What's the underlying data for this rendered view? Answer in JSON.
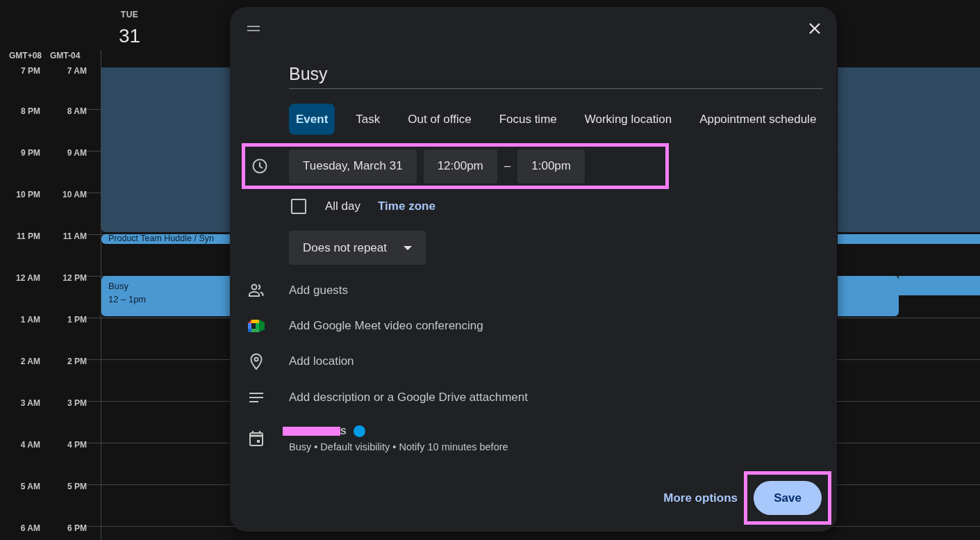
{
  "day": {
    "weekday": "TUE",
    "date": "31"
  },
  "timezones": [
    "GMT+08",
    "GMT-04"
  ],
  "hours": [
    {
      "local": "7 PM",
      "other": "7 AM"
    },
    {
      "local": "8 PM",
      "other": "8 AM"
    },
    {
      "local": "9 PM",
      "other": "9 AM"
    },
    {
      "local": "10 PM",
      "other": "10 AM"
    },
    {
      "local": "11 PM",
      "other": "11 AM"
    },
    {
      "local": "12 AM",
      "other": "12 PM"
    },
    {
      "local": "1 AM",
      "other": "1 PM"
    },
    {
      "local": "2 AM",
      "other": "2 PM"
    },
    {
      "local": "3 AM",
      "other": "3 PM"
    },
    {
      "local": "4 AM",
      "other": "4 PM"
    },
    {
      "local": "5 AM",
      "other": "5 PM"
    },
    {
      "local": "6 AM",
      "other": "6 PM"
    }
  ],
  "events": [
    {
      "kind": "block"
    },
    {
      "kind": "chip",
      "title": "Product Team Huddle / Syn"
    },
    {
      "kind": "timed",
      "title": "Busy",
      "time": "12 – 1pm"
    },
    {
      "kind": "strip"
    }
  ],
  "dialog": {
    "title_value": "Busy",
    "tabs": [
      {
        "label": "Event",
        "selected": true
      },
      {
        "label": "Task",
        "selected": false
      },
      {
        "label": "Out of office",
        "selected": false
      },
      {
        "label": "Focus time",
        "selected": false
      },
      {
        "label": "Working location",
        "selected": false
      },
      {
        "label": "Appointment schedule",
        "selected": false
      }
    ],
    "datetime": {
      "highlighted": true,
      "date": "Tuesday, March 31",
      "start": "12:00pm",
      "separator": "–",
      "end": "1:00pm"
    },
    "all_day": {
      "label": "All day",
      "checked": false
    },
    "time_zone_link": "Time zone",
    "repeat": "Does not repeat",
    "options": [
      {
        "kind": "guests",
        "label": "Add guests"
      },
      {
        "kind": "meet",
        "label": "Add Google Meet video conferencing"
      },
      {
        "kind": "location",
        "label": "Add location"
      },
      {
        "kind": "description",
        "label": "Add description or a Google Drive attachment"
      }
    ],
    "calendar": {
      "name": "s",
      "redacted": true,
      "details": "Busy • Default visibility • Notify 10 minutes before"
    },
    "more_options": "More options",
    "save": {
      "label": "Save",
      "highlighted": true
    }
  }
}
